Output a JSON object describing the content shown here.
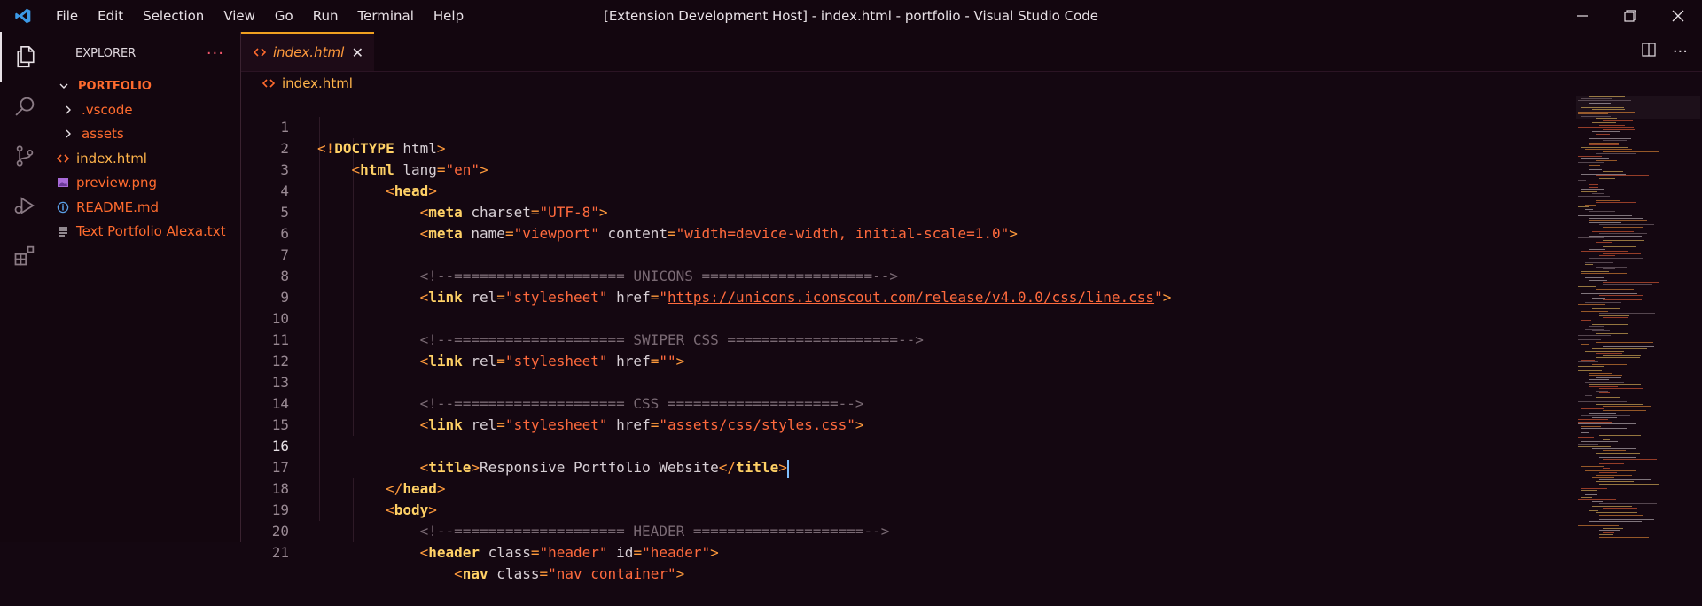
{
  "menu": [
    "File",
    "Edit",
    "Selection",
    "View",
    "Go",
    "Run",
    "Terminal",
    "Help"
  ],
  "window_title": "[Extension Development Host] - index.html - portfolio - Visual Studio Code",
  "activity_bar": [
    "explorer-icon",
    "search-icon",
    "source-control-icon",
    "run-debug-icon",
    "extensions-icon"
  ],
  "sidebar": {
    "title": "EXPLORER",
    "more": "···",
    "root": "PORTFOLIO",
    "items": [
      {
        "label": ".vscode",
        "icon": "chevron-right-icon"
      },
      {
        "label": "assets",
        "icon": "chevron-right-icon"
      },
      {
        "label": "index.html",
        "icon": "html-file-icon"
      },
      {
        "label": "preview.png",
        "icon": "image-file-icon"
      },
      {
        "label": "README.md",
        "icon": "info-file-icon"
      },
      {
        "label": "Text Portfolio Alexa.txt",
        "icon": "text-file-icon"
      }
    ]
  },
  "tab": {
    "label": "index.html",
    "close": "✕"
  },
  "breadcrumb": "index.html",
  "editor": {
    "line_numbers": [
      "1",
      "2",
      "3",
      "4",
      "5",
      "6",
      "7",
      "8",
      "9",
      "10",
      "11",
      "12",
      "13",
      "14",
      "15",
      "16",
      "17",
      "18",
      "19",
      "20",
      "21"
    ],
    "current_line": "16",
    "text": {
      "doctype_open": "<!",
      "doctype_kw": "DOCTYPE",
      "doctype_rest": " html",
      "doctype_close": ">",
      "html": "html",
      "lang_attr": " lang",
      "lang_val": "\"en\"",
      "head": "head",
      "meta": "meta",
      "charset_attr": " charset",
      "charset_val": "\"UTF-8\"",
      "name_attr": " name",
      "name_val": "\"viewport\"",
      "content_attr": " content",
      "content_val": "\"width=device-width, initial-scale=1.0\"",
      "c_unicons": "<!--==================== UNICONS ====================-->",
      "link": "link",
      "rel_attr": " rel",
      "rel_val": "\"stylesheet\"",
      "href_attr": " href",
      "q": "\"",
      "unicons_url": "https://unicons.iconscout.com/release/v4.0.0/css/line.css",
      "c_swiper": "<!--==================== SWIPER CSS ====================-->",
      "empty_val": "\"\"",
      "c_css": "<!--==================== CSS ====================-->",
      "css_val": "\"assets/css/styles.css\"",
      "title": "title",
      "title_text": "Responsive Portfolio Website",
      "head_close": "head",
      "body": "body",
      "c_header": "<!--==================== HEADER ====================-->",
      "header": "header",
      "class_attr": " class",
      "header_class": "\"header\"",
      "id_attr": " id",
      "header_id": "\"header\"",
      "nav": "nav",
      "nav_class": "\"nav container\""
    }
  },
  "colors": {
    "accent": "#ff6b2e",
    "tag": "#ffd166",
    "string": "#ff6a3d",
    "background": "#140711"
  }
}
